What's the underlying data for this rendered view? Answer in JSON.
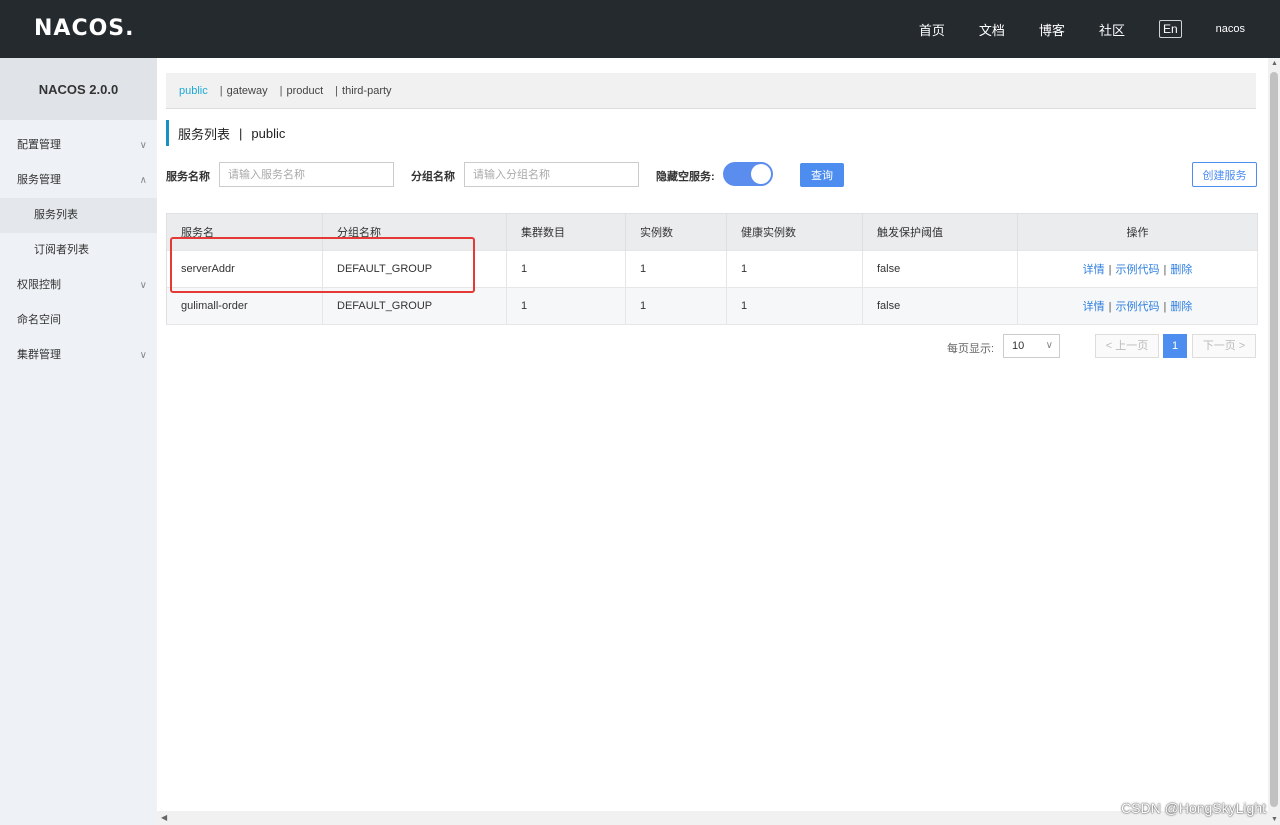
{
  "header": {
    "logo": "NACOS.",
    "nav": [
      "首页",
      "文档",
      "博客",
      "社区"
    ],
    "lang": "En",
    "user": "nacos"
  },
  "sidebar": {
    "version": "NACOS 2.0.0",
    "items": [
      {
        "label": "配置管理",
        "chevron": "∨"
      },
      {
        "label": "服务管理",
        "chevron": "∧"
      },
      {
        "label": "服务列表"
      },
      {
        "label": "订阅者列表"
      },
      {
        "label": "权限控制",
        "chevron": "∨"
      },
      {
        "label": "命名空间"
      },
      {
        "label": "集群管理",
        "chevron": "∨"
      }
    ]
  },
  "namespaces": [
    "public",
    "gateway",
    "product",
    "third-party"
  ],
  "page": {
    "title": "服务列表",
    "namespace": "public"
  },
  "search": {
    "service_label": "服务名称",
    "service_placeholder": "请输入服务名称",
    "group_label": "分组名称",
    "group_placeholder": "请输入分组名称",
    "hide_empty_label": "隐藏空服务:",
    "hide_empty_on": true,
    "query_button": "查询",
    "create_button": "创建服务"
  },
  "table": {
    "headers": [
      "服务名",
      "分组名称",
      "集群数目",
      "实例数",
      "健康实例数",
      "触发保护阈值",
      "操作"
    ],
    "rows": [
      {
        "name": "serverAddr",
        "group": "DEFAULT_GROUP",
        "clusters": "1",
        "instances": "1",
        "healthy": "1",
        "threshold": "false"
      },
      {
        "name": "gulimall-order",
        "group": "DEFAULT_GROUP",
        "clusters": "1",
        "instances": "1",
        "healthy": "1",
        "threshold": "false"
      }
    ],
    "actions": {
      "detail": "详情",
      "sample": "示例代码",
      "delete": "删除",
      "sep": "|"
    }
  },
  "pager": {
    "page_size_label": "每页显示:",
    "page_size": "10",
    "prev": "< 上一页",
    "current": "1",
    "next": "下一页 >"
  },
  "watermark": "CSDN @HongSkyLight"
}
